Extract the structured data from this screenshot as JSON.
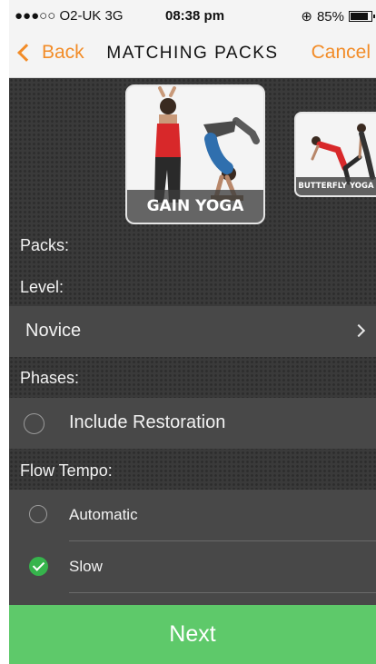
{
  "status_bar": {
    "carrier": "●●●○○ O2-UK  3G",
    "time": "08:38 pm",
    "battery_percent": "85%"
  },
  "nav": {
    "back_label": "Back",
    "title": "MATCHING PACKS",
    "cancel_label": "Cancel",
    "accent_color": "#f28c28"
  },
  "packs": {
    "items": [
      {
        "caption": "GAIN YOGA",
        "selected": true
      },
      {
        "caption": "BUTTERFLY YOGA",
        "selected": false
      }
    ]
  },
  "sections": {
    "packs_label": "Packs:",
    "level_label": "Level:",
    "level_value": "Novice",
    "phases_label": "Phases:",
    "restoration_label": "Include Restoration",
    "restoration_selected": false,
    "flow_tempo_label": "Flow Tempo:",
    "tempo_options": [
      {
        "label": "Automatic",
        "selected": false
      },
      {
        "label": "Slow",
        "selected": true
      }
    ]
  },
  "footer": {
    "next_label": "Next",
    "button_color": "#5ec96a"
  }
}
